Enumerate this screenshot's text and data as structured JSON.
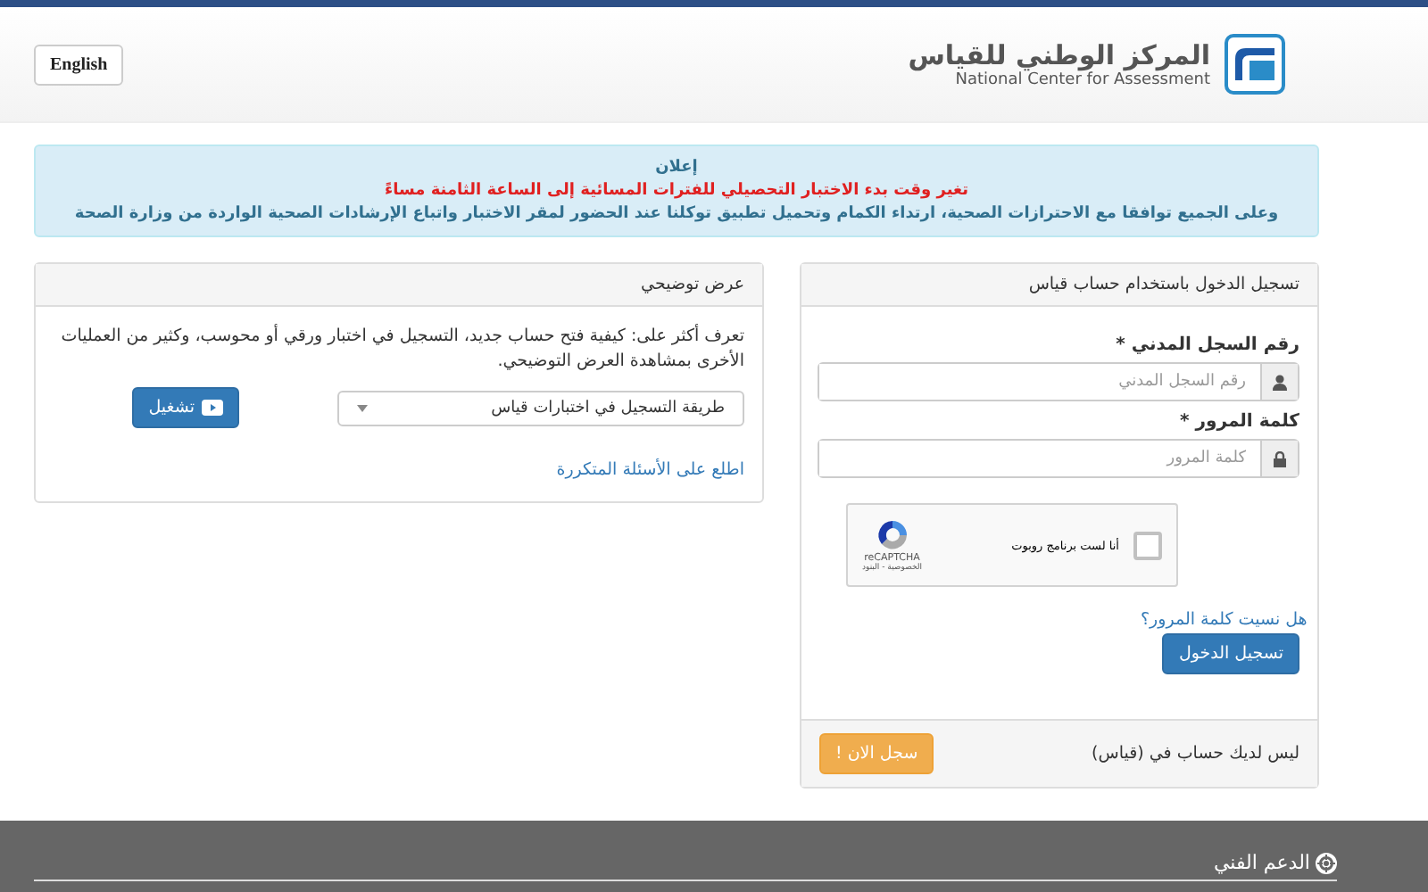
{
  "header": {
    "language_button": "English",
    "logo_title": "المركز الوطني للقياس",
    "logo_subtitle": "National Center for Assessment"
  },
  "announcement": {
    "title": "إعلان",
    "alert": "تغير وقت بدء الاختبار التحصيلي للفترات المسائية إلى الساعة الثامنة مساءً",
    "message": "وعلى الجميع توافقا مع الاحترازات الصحية، ارتداء الكمام وتحميل تطبيق توكلنا عند الحضور لمقر الاختبار واتباع الإرشادات الصحية الواردة من وزارة الصحة"
  },
  "login_panel": {
    "title": "تسجيل الدخول باستخدام حساب قياس",
    "fields": [
      {
        "label": "رقم السجل المدني *",
        "placeholder": "رقم السجل المدني",
        "kind": "user"
      },
      {
        "label": "كلمة المرور *",
        "placeholder": "كلمة المرور",
        "kind": "lock"
      }
    ],
    "captcha": {
      "label": "أنا لست برنامج روبوت",
      "checked": false,
      "brand": "reCAPTCHA",
      "links": "الخصوصية - البنود"
    },
    "forgot_link": "هل نسيت كلمة المرور؟",
    "login_button": "تسجيل الدخول",
    "no_account_text": "ليس لديك حساب في (قياس)",
    "register_button": "سجل الان !"
  },
  "demo_panel": {
    "title": "عرض توضيحي",
    "description": "تعرف أكثر على: كيفية فتح حساب جديد، التسجيل في اختبار ورقي أو محوسب، وكثير من العمليات الأخرى بمشاهدة العرض التوضيحي.",
    "select_value": "طريقة التسجيل في اختبارات قياس",
    "play_button": "تشغيل",
    "faq_link": "اطلع على الأسئلة المتكررة"
  },
  "footer": {
    "support": "الدعم الفني"
  }
}
